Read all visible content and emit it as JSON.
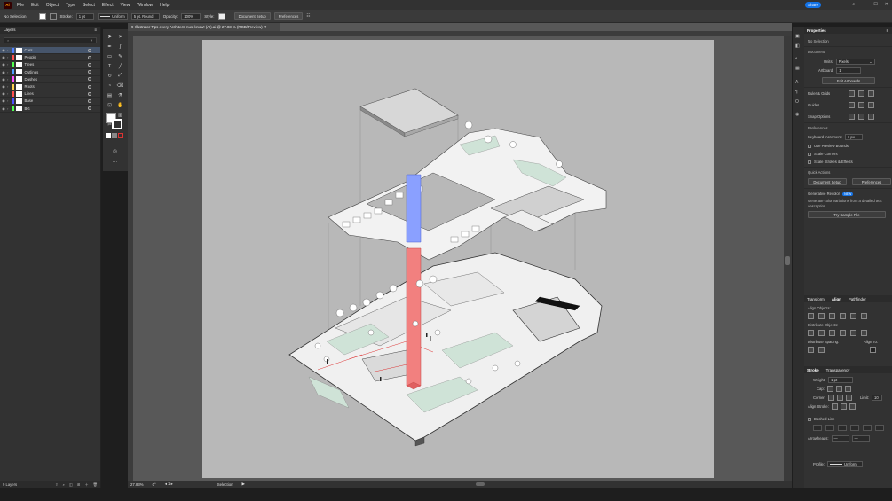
{
  "app": {
    "logo": "Ai"
  },
  "menu": [
    "File",
    "Edit",
    "Object",
    "Type",
    "Select",
    "Effect",
    "View",
    "Window",
    "Help"
  ],
  "share_label": "Share",
  "window_icons": [
    "search-icon",
    "minimize-icon",
    "maximize-icon",
    "close-icon"
  ],
  "control_bar": {
    "selection": "No Selection",
    "stroke_label": "Stroke:",
    "stroke_value": "1 pt",
    "stroke_profile": "Uniform",
    "brush": "5 pt. Round",
    "opacity_label": "Opacity:",
    "opacity_value": "100%",
    "style_label": "Style:",
    "doc_setup": "Document Setup",
    "preferences": "Preferences"
  },
  "document_tab": "9 Illustrator Tips every Architect must know! (AI).ai @ 27.83 % (RGB/Preview)",
  "layers_panel": {
    "title": "Layers",
    "layers": [
      {
        "name": "Cars",
        "color": "#4f7fff",
        "selected": true
      },
      {
        "name": "People",
        "color": "#ff4f4f",
        "selected": false
      },
      {
        "name": "Trees",
        "color": "#4fff4f",
        "selected": false
      },
      {
        "name": "Outlines",
        "color": "#4fa0ff",
        "selected": false
      },
      {
        "name": "Dashes",
        "color": "#ff4fff",
        "selected": false
      },
      {
        "name": "Roots",
        "color": "#ffd04f",
        "selected": false
      },
      {
        "name": "Lines",
        "color": "#ff4f4f",
        "selected": false
      },
      {
        "name": "Base",
        "color": "#4f4fff",
        "selected": false
      },
      {
        "name": "BG",
        "color": "#4fff4f",
        "selected": false
      }
    ],
    "footer": "9 Layers"
  },
  "status_bar": {
    "zoom": "27.83%",
    "rotation": "0°",
    "artboard": "1",
    "tool": "Selection"
  },
  "properties_panel": {
    "title": "Properties",
    "no_selection": "No Selection",
    "document_label": "Document",
    "units_label": "Units:",
    "units_value": "Pixels",
    "artboard_label": "Artboard:",
    "artboard_value": "1",
    "edit_artboards": "Edit Artboards",
    "ruler_grids": "Ruler & Grids",
    "guides": "Guides",
    "snap_options": "Snap Options",
    "preferences_title": "Preferences",
    "keyboard_increment_label": "Keyboard Increment:",
    "keyboard_increment_value": "1 px",
    "use_preview_bounds": "Use Preview Bounds",
    "scale_corners": "Scale Corners",
    "scale_strokes": "Scale Strokes & Effects",
    "quick_actions": "Quick Actions",
    "doc_setup_btn": "Document Setup",
    "preferences_btn": "Preferences",
    "recolor_title": "Generative Recolor",
    "new_badge": "NEW",
    "recolor_desc": "Generate color variations from a detailed text description.",
    "try_sample": "Try Sample File"
  },
  "align_panel": {
    "tabs": [
      "Transform",
      "Align",
      "Pathfinder"
    ],
    "align_objects": "Align Objects:",
    "distribute_objects": "Distribute Objects:",
    "distribute_spacing": "Distribute Spacing:",
    "align_to": "Align To:"
  },
  "stroke_panel": {
    "tabs": [
      "Stroke",
      "Transparency"
    ],
    "weight_label": "Weight:",
    "weight_value": "1 pt",
    "cap_label": "Cap:",
    "corner_label": "Corner:",
    "limit_label": "Limit:",
    "limit_value": "10",
    "align_stroke_label": "Align Stroke:",
    "dashed_line": "Dashed Line",
    "arrowheads_label": "Arrowheads:",
    "profile_label": "Profile:",
    "profile_value": "Uniform"
  }
}
